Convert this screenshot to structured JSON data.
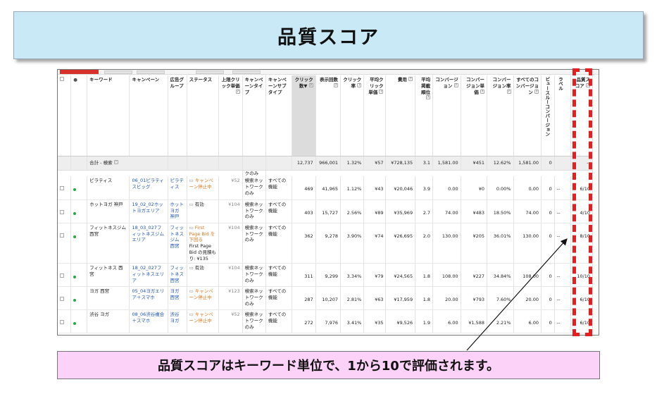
{
  "title": "品質スコア",
  "caption": "品質スコアはキーワード単位で、1から10で評価されます。",
  "colors": {
    "banner_bg": "#c9e9f7",
    "caption_bg": "#fcd2f8",
    "highlight": "#e41f1f",
    "status_green": "#2aa84a",
    "link": "#1f56b3",
    "paused": "#e3771e"
  },
  "table": {
    "headers": {
      "keyword": "キーワード",
      "campaign": "キャンペーン",
      "adgroup": "広告グループ",
      "status": "ステータス",
      "maxcpc": "上限クリック単価",
      "camptype": "キャンペーンタイプ",
      "campsub": "キャンペーンサブタイプ",
      "clicks": "クリック数",
      "impr": "表示回数",
      "ctr": "クリック率",
      "avgcpc": "平均クリック単価",
      "cost": "費用",
      "avgpos": "平均掲載順位",
      "conv": "コンバージョン",
      "costconv": "コンバージョン単価",
      "convrate": "コンバージョン率",
      "allconv": "すべてのコンバージョン",
      "viewconv": "ビュースルーコンバージョン",
      "label": "ラベル",
      "qs": "品質スコア",
      "help": "?",
      "sort": "▼",
      "dot": "●"
    },
    "total": {
      "label": "合計 - 検索",
      "clicks": "12,737",
      "impr": "966,001",
      "ctr": "1.32%",
      "avgcpc": "¥57",
      "cost": "¥728,135",
      "avgpos": "3.1",
      "conv": "1,581.00",
      "costconv": "¥451",
      "convrate": "12.62%",
      "allconv": "1,581.00",
      "viewconv": "0",
      "qs": "--"
    },
    "cutoff_camptype": "クのみ",
    "rows": [
      {
        "keyword": "ピラティス",
        "campaign": "06_01ピラティスビッグ",
        "adgroup": "ピラティス",
        "status": "キャンペーン停止中",
        "maxcpc": "¥52",
        "camptype": "検索ネットワークのみ",
        "campsub": "すべての機能",
        "clicks": "469",
        "impr": "41,965",
        "ctr": "1.12%",
        "avgcpc": "¥43",
        "cost": "¥20,046",
        "avgpos": "3.9",
        "conv": "0.00",
        "costconv": "¥0",
        "convrate": "0.00%",
        "allconv": "0.00",
        "viewconv": "0",
        "label": "--",
        "qs": "6/10"
      },
      {
        "keyword": "ホットヨガ 神戸",
        "campaign": "19_02_02ホットヨガエリア",
        "adgroup": "ホットヨガ 神戸",
        "status": "有効",
        "maxcpc": "¥104",
        "camptype": "検索ネットワークのみ",
        "campsub": "すべての機能",
        "clicks": "403",
        "impr": "15,727",
        "ctr": "2.56%",
        "avgcpc": "¥89",
        "cost": "¥35,969",
        "avgpos": "2.7",
        "conv": "74.00",
        "costconv": "¥483",
        "convrate": "18.50%",
        "allconv": "74.00",
        "viewconv": "0",
        "label": "--",
        "qs": "4/10"
      },
      {
        "keyword": "フィットネスジム 西宮",
        "campaign": "18_03_027フィットネスジムエリア",
        "adgroup": "フィットネスジム 西宮",
        "status": "First Page Bid を下回る",
        "status_note": "First Page Bid の見積もり: ¥135",
        "maxcpc": "¥104",
        "camptype": "検索ネットワークのみ",
        "campsub": "すべての機能",
        "clicks": "362",
        "impr": "9,278",
        "ctr": "3.90%",
        "avgcpc": "¥74",
        "cost": "¥26,695",
        "avgpos": "2.0",
        "conv": "130.00",
        "costconv": "¥205",
        "convrate": "36.01%",
        "allconv": "130.00",
        "viewconv": "0",
        "label": "--",
        "qs": "8/10"
      },
      {
        "keyword": "フィットネス 西宮",
        "campaign": "18_02_027フィットネスエリア",
        "adgroup": "フィットネス 西宮",
        "status": "有効",
        "maxcpc": "¥104",
        "camptype": "検索ネットワークのみ",
        "campsub": "すべての機能",
        "clicks": "311",
        "impr": "9,299",
        "ctr": "3.34%",
        "avgcpc": "¥79",
        "cost": "¥24,565",
        "avgpos": "1.8",
        "conv": "108.00",
        "costconv": "¥227",
        "convrate": "34.84%",
        "allconv": "108.00",
        "viewconv": "0",
        "label": "--",
        "qs": "10/10"
      },
      {
        "keyword": "ヨガ 西宮",
        "campaign": "05_04ヨガエリア＋スマホ",
        "adgroup": "ヨガ 西宮",
        "status": "キャンペーン停止中",
        "maxcpc": "¥123",
        "camptype": "検索ネットワークのみ",
        "campsub": "すべての機能",
        "clicks": "287",
        "impr": "10,207",
        "ctr": "2.81%",
        "avgcpc": "¥63",
        "cost": "¥17,959",
        "avgpos": "1.8",
        "conv": "20.00",
        "costconv": "¥793",
        "convrate": "7.60%",
        "allconv": "20.00",
        "viewconv": "0",
        "label": "--",
        "qs": "6/10"
      },
      {
        "keyword": "渋谷 ヨガ",
        "campaign": "08_06渋谷複合＋スマホ",
        "adgroup": "渋谷 ヨガ",
        "status": "キャンペーン停止中",
        "maxcpc": "¥52",
        "camptype": "検索ネットワークのみ",
        "campsub": "すべての機能",
        "clicks": "272",
        "impr": "7,976",
        "ctr": "3.41%",
        "avgcpc": "¥35",
        "cost": "¥9,526",
        "avgpos": "1.9",
        "conv": "6.00",
        "costconv": "¥1,588",
        "convrate": "2.21%",
        "allconv": "6.00",
        "viewconv": "0",
        "label": "--",
        "qs": "6/10"
      }
    ]
  }
}
